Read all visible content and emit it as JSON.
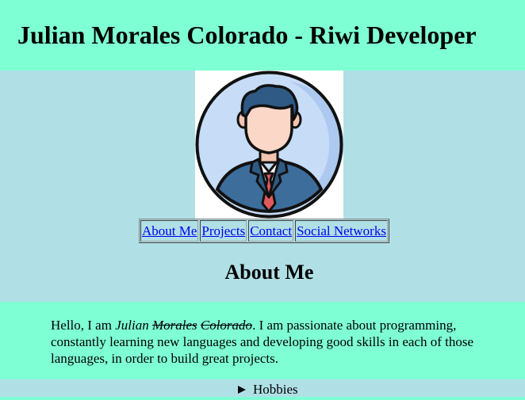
{
  "header": {
    "title": "Julian Morales Colorado - Riwi Developer"
  },
  "avatar": {
    "icon": "developer-avatar-icon"
  },
  "nav": {
    "items": [
      {
        "label": "About Me"
      },
      {
        "label": "Projects"
      },
      {
        "label": "Contact"
      },
      {
        "label": "Social Networks"
      }
    ]
  },
  "about": {
    "heading": "About Me",
    "intro": "Hello, I am",
    "first_name": "Julian",
    "middle_name": "Morales",
    "last_name": "Colorado",
    "text": ". I am passionate about programming, constantly learning new languages and developing good skills in each of those languages, in order to build great projects."
  },
  "hobbies": {
    "summary": "Hobbies"
  },
  "colors": {
    "header_bg": "#7fffd4",
    "page_bg": "#b0e0e6",
    "link": "#0000ee"
  }
}
